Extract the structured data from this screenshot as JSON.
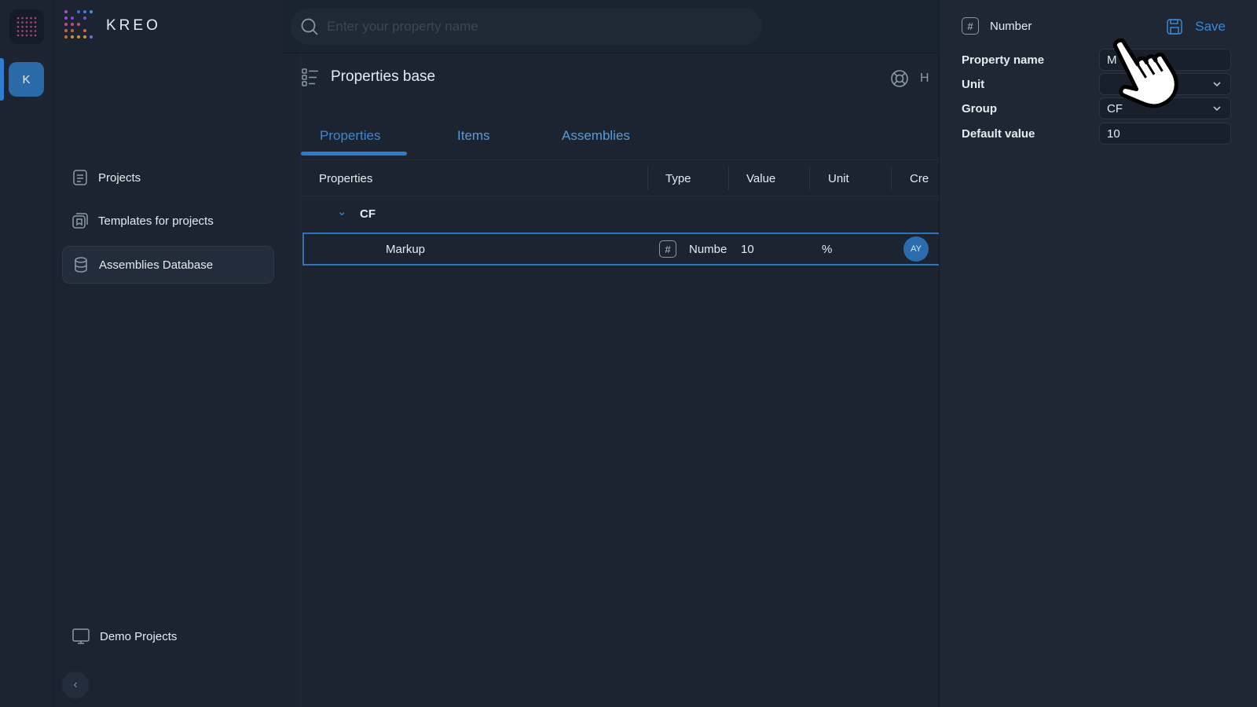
{
  "rail": {
    "workspace_initial": "K"
  },
  "sidebar": {
    "brand": "KREO",
    "items": [
      {
        "label": "Projects",
        "icon": "document-list-icon"
      },
      {
        "label": "Templates for projects",
        "icon": "templates-icon"
      },
      {
        "label": "Assemblies Database",
        "icon": "database-icon",
        "active": true
      }
    ],
    "footer_item": {
      "label": "Demo Projects",
      "icon": "monitor-icon"
    },
    "collapse_symbol": "‹"
  },
  "search": {
    "placeholder": "Enter your property name",
    "value": ""
  },
  "page": {
    "title": "Properties base",
    "head_right_text": "H"
  },
  "tabs": [
    {
      "label": "Properties",
      "active": true
    },
    {
      "label": "Items"
    },
    {
      "label": "Assemblies"
    }
  ],
  "table": {
    "columns": [
      "Properties",
      "Type",
      "Value",
      "Unit",
      "Cre"
    ],
    "group": {
      "name": "CF",
      "chevron": "⌄"
    },
    "rows": [
      {
        "name": "Markup",
        "type_icon": "#",
        "type": "Numbe",
        "value": "10",
        "unit": "%",
        "creator_initials": "AY"
      }
    ]
  },
  "panel": {
    "type_icon": "#",
    "type_label": "Number",
    "save_label": "Save",
    "fields": {
      "property_name": {
        "label": "Property name",
        "value": "M"
      },
      "unit": {
        "label": "Unit",
        "value": ""
      },
      "group": {
        "label": "Group",
        "value": "CF"
      },
      "default_value": {
        "label": "Default value",
        "value": "10"
      }
    }
  },
  "colors": {
    "accent": "#3b87d4",
    "background": "#1a2330",
    "panel": "#1e2733",
    "avatar": "#2b6cae"
  }
}
